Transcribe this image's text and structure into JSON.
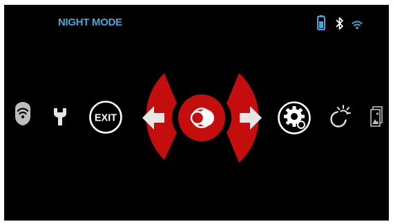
{
  "header": {
    "mode_title": "NIGHT MODE"
  },
  "status": {
    "battery_icon": "battery-icon",
    "bluetooth_icon": "bluetooth-icon",
    "wifi_icon": "wifi-icon"
  },
  "menu": {
    "items": [
      {
        "icon": "shield-wifi-icon"
      },
      {
        "icon": "wrench-icon"
      },
      {
        "icon": "exit-icon",
        "label": "EXIT"
      },
      {
        "icon": "arrow-left-icon"
      },
      {
        "icon": "mode-toggle-icon"
      },
      {
        "icon": "arrow-right-icon"
      },
      {
        "icon": "settings-gear-icon"
      },
      {
        "icon": "day-night-icon"
      },
      {
        "icon": "gallery-icon"
      }
    ]
  },
  "colors": {
    "background": "#000000",
    "accent": "#c40d0d",
    "title": "#4aa6d9",
    "icon": "#e6e6e6"
  }
}
